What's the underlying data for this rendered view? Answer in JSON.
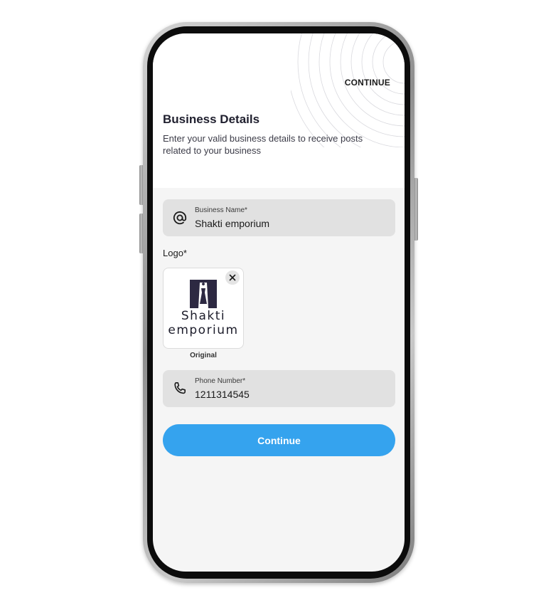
{
  "header": {
    "continue_label": "CONTINUE",
    "title": "Business Details",
    "subtitle": "Enter your valid business details to receive posts related to your business"
  },
  "business_name_field": {
    "label": "Business Name*",
    "value": "Shakti emporium",
    "icon": "at-icon"
  },
  "logo": {
    "label": "Logo*",
    "brand_line1": "Shakti",
    "brand_line2": "emporium",
    "caption": "Original",
    "remove_icon": "close-icon"
  },
  "phone_field": {
    "label": "Phone Number*",
    "value": "1211314545",
    "icon": "phone-icon"
  },
  "primary_button": {
    "label": "Continue"
  },
  "colors": {
    "accent": "#35a3ee",
    "screen_bg": "#f5f5f5",
    "field_bg": "#e1e1e1",
    "text_dark": "#1f1f2e"
  }
}
